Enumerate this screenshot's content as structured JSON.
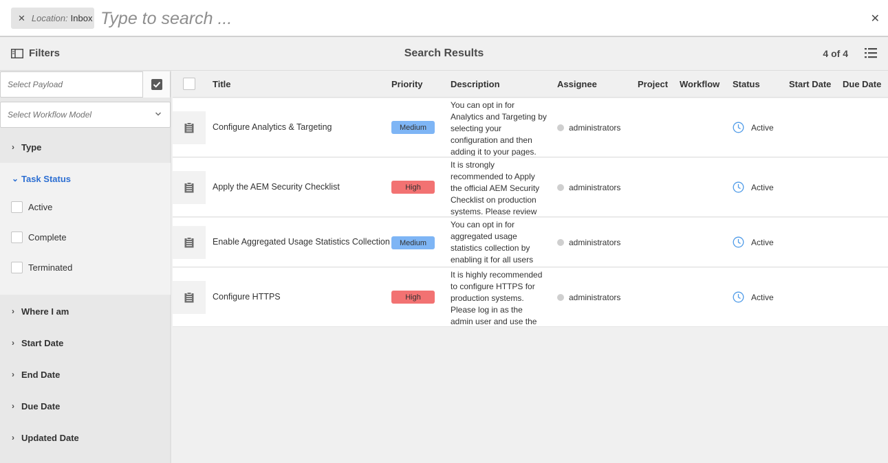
{
  "search": {
    "tag_key": "Location:",
    "tag_value": "Inbox",
    "placeholder": "Type to search ..."
  },
  "header": {
    "filters_label": "Filters",
    "title": "Search Results",
    "count": "4 of 4"
  },
  "sidebar": {
    "payload_placeholder": "Select Payload",
    "model_placeholder": "Select Workflow Model",
    "sections": {
      "type": "Type",
      "task_status": "Task Status",
      "where": "Where I am",
      "start_date": "Start Date",
      "end_date": "End Date",
      "due_date": "Due Date",
      "updated_date": "Updated Date"
    },
    "status_options": [
      "Active",
      "Complete",
      "Terminated"
    ]
  },
  "table": {
    "columns": [
      "Title",
      "Priority",
      "Description",
      "Assignee",
      "Project",
      "Workflow",
      "Status",
      "Start Date",
      "Due Date"
    ],
    "rows": [
      {
        "title": "Configure Analytics & Targeting",
        "priority": "Medium",
        "description": "You can opt in for Analytics and Targeting by selecting your configuration and then adding it to your pages.",
        "assignee": "administrators",
        "status": "Active"
      },
      {
        "title": "Apply the AEM Security Checklist",
        "priority": "High",
        "description": "It is strongly recommended to Apply the official AEM Security Checklist on production systems. Please review",
        "assignee": "administrators",
        "status": "Active"
      },
      {
        "title": "Enable Aggregated Usage Statistics Collection",
        "priority": "Medium",
        "description": "You can opt in for aggregated usage statistics collection by enabling it for all users",
        "assignee": "administrators",
        "status": "Active"
      },
      {
        "title": "Configure HTTPS",
        "priority": "High",
        "description": "It is highly recommended to configure HTTPS for production systems. Please log in as the admin user and use the",
        "assignee": "administrators",
        "status": "Active"
      }
    ]
  },
  "colors": {
    "priority_medium": "#7eb5f5",
    "priority_high": "#f27272",
    "accent": "#2d6fd2",
    "status_icon": "#4f9be8"
  }
}
